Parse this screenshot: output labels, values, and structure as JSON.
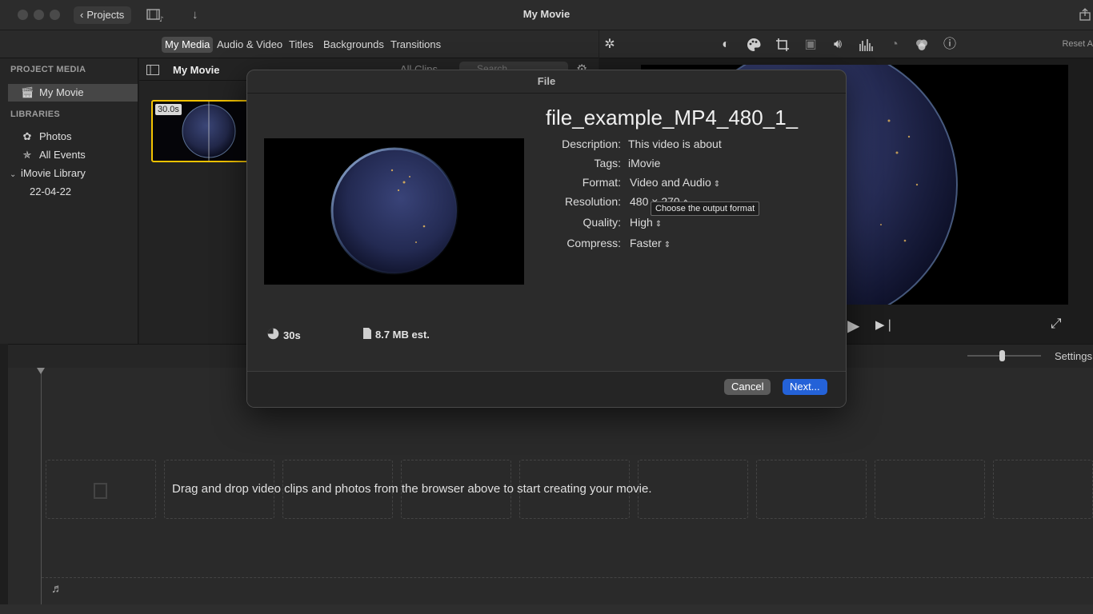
{
  "window": {
    "title": "My Movie",
    "projects_label": "Projects"
  },
  "media_tabs": [
    "My Media",
    "Audio & Video",
    "Titles",
    "Backgrounds",
    "Transitions"
  ],
  "viewer_toolbar": {
    "reset_label": "Reset A"
  },
  "sidebar": {
    "project_media_header": "PROJECT MEDIA",
    "project_item": "My Movie",
    "libraries_header": "LIBRARIES",
    "photos": "Photos",
    "all_events": "All Events",
    "library": "iMovie Library",
    "event": "22-04-22"
  },
  "browser": {
    "title": "My Movie",
    "clips_filter": "All Clips",
    "search_placeholder": "Search",
    "clip_duration": "30.0s"
  },
  "timeline": {
    "settings_label": "Settings",
    "empty_message": "Drag and drop video clips and photos from the browser above to start creating your movie."
  },
  "dialog": {
    "title": "File",
    "filename": "file_example_MP4_480_1_",
    "description_label": "Description:",
    "description_value": "This video is about",
    "tags_label": "Tags:",
    "tags_value": "iMovie",
    "format_label": "Format:",
    "format_value": "Video and Audio",
    "resolution_label": "Resolution:",
    "resolution_value": "480 × 270",
    "quality_label": "Quality:",
    "quality_value": "High",
    "compress_label": "Compress:",
    "compress_value": "Faster",
    "tooltip": "Choose the output format",
    "duration": "30s",
    "size": "8.7 MB est.",
    "cancel_label": "Cancel",
    "next_label": "Next..."
  },
  "colors": {
    "accent_blue": "#2462d8",
    "clip_selection": "#f2c200"
  }
}
